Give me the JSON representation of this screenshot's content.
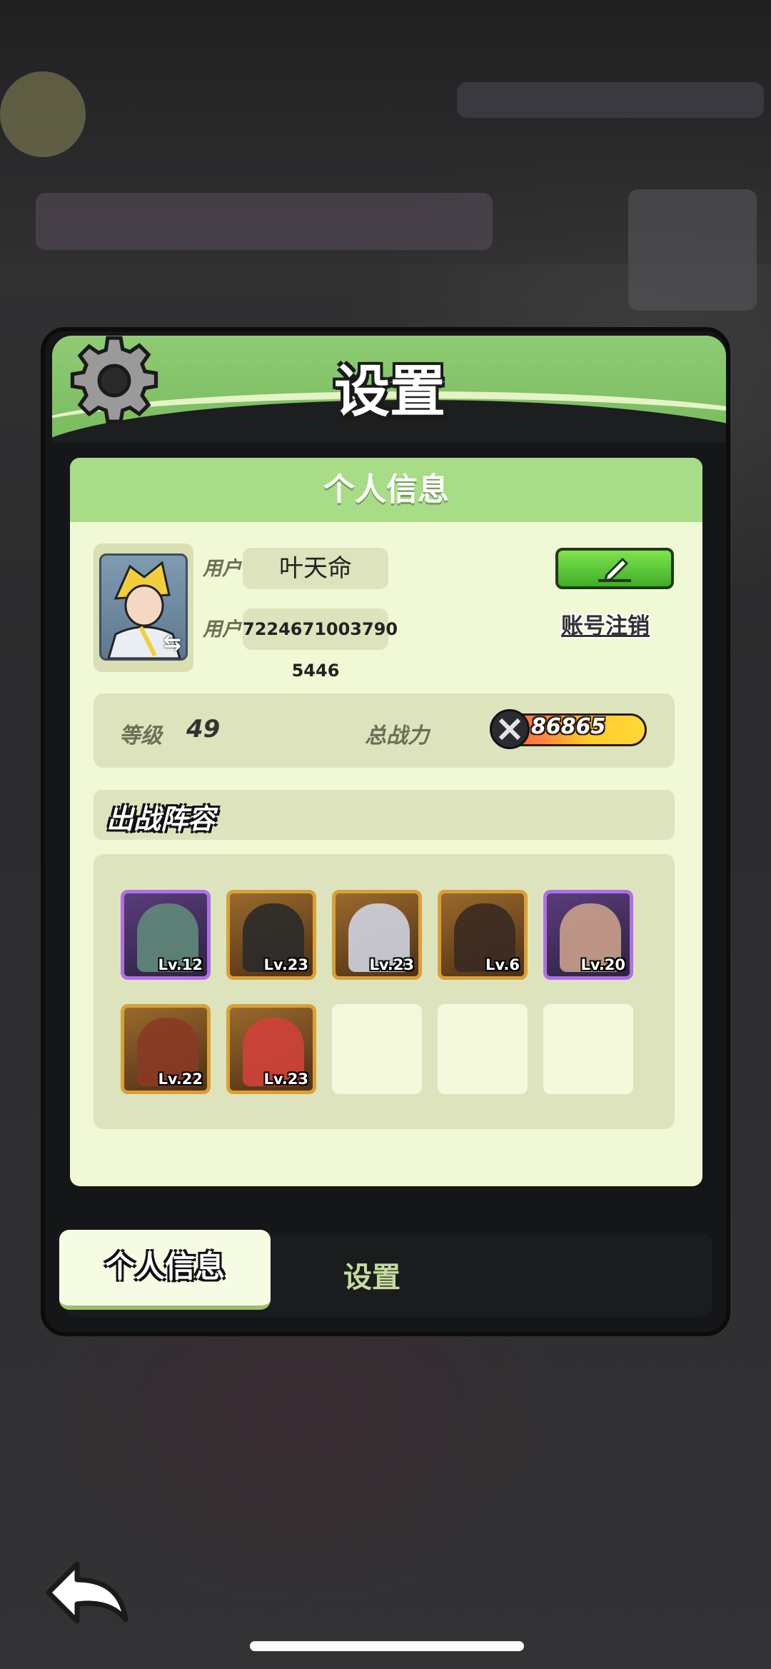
{
  "window": {
    "title": "设置"
  },
  "profile_section": {
    "header": "个人信息",
    "nickname_label": "用户昵称",
    "nickname_value": "叶天命",
    "id_label": "用户 ID",
    "id_value": "7224671003790 5446",
    "account_cancel_link": "账号注销"
  },
  "stats": {
    "level_label": "等级",
    "level_value": "49",
    "power_label": "总战力",
    "power_value": "86865"
  },
  "lineup": {
    "title": "出战阵容",
    "heroes": [
      {
        "level": "Lv.12",
        "frame": "purple",
        "color": "#5f8a7a"
      },
      {
        "level": "Lv.23",
        "frame": "gold",
        "color": "#2a2a2a"
      },
      {
        "level": "Lv.23",
        "frame": "gold",
        "color": "#cfd3e0"
      },
      {
        "level": "Lv.6",
        "frame": "gold",
        "color": "#3a2a22"
      },
      {
        "level": "Lv.20",
        "frame": "purple",
        "color": "#c9a08a"
      },
      {
        "level": "Lv.22",
        "frame": "gold",
        "color": "#8a3a25"
      },
      {
        "level": "Lv.23",
        "frame": "gold",
        "color": "#d0413a"
      }
    ],
    "empty_slots": 3
  },
  "tabs": {
    "active": "个人信息",
    "inactive": "设置"
  },
  "colors": {
    "accent_green": "#79bb5d",
    "card_bg": "#f1f8d5",
    "epic_frame": "#b26ee8",
    "legend_frame": "#d9a037"
  }
}
